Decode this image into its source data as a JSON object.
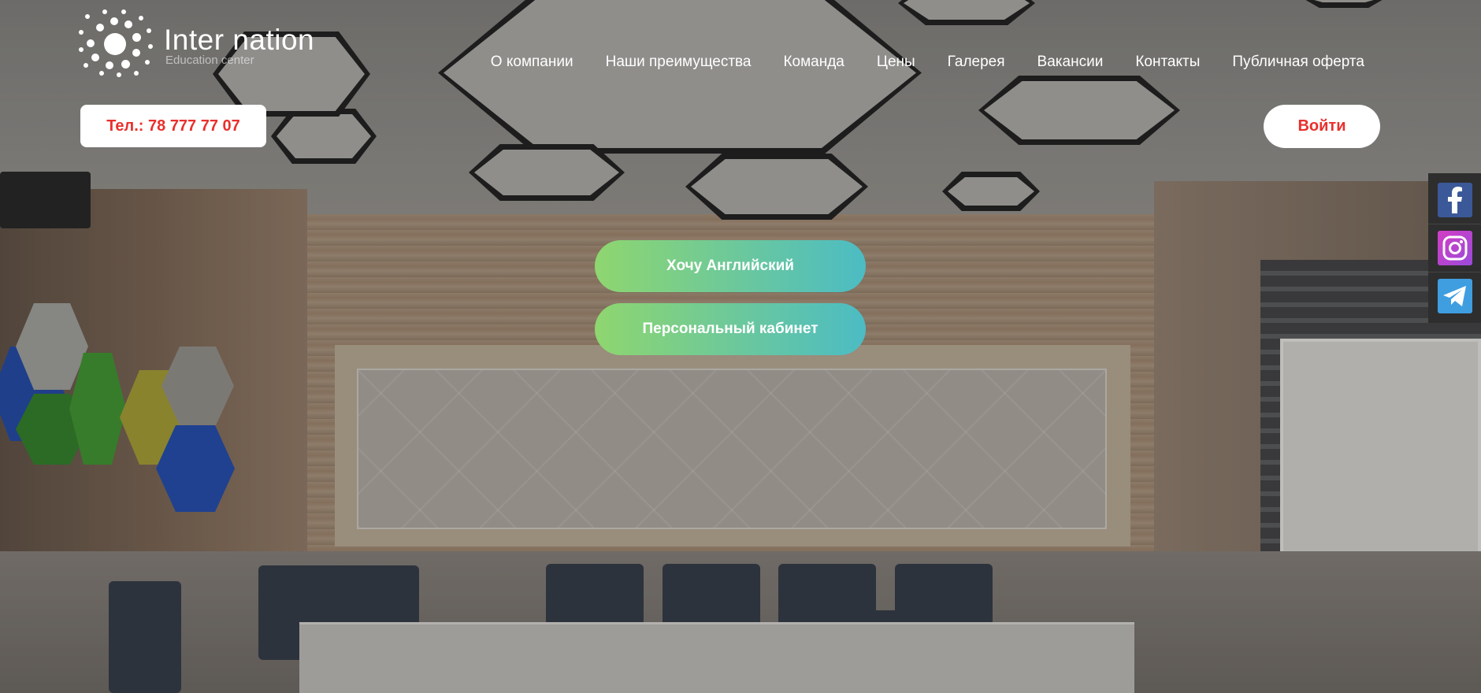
{
  "header": {
    "logo_title": "Inter nation",
    "logo_subtitle": "Education center",
    "nav": [
      "О компании",
      "Наши преимущества",
      "Команда",
      "Цены",
      "Галерея",
      "Вакансии",
      "Контакты",
      "Публичная оферта"
    ],
    "phone_label": "Тел.: 78 777 77 07",
    "login_label": "Войти"
  },
  "hero": {
    "cta_primary": "Хочу Английский",
    "cta_secondary": "Персональный кабинет"
  },
  "social": [
    {
      "icon": "facebook-icon"
    },
    {
      "icon": "instagram-icon"
    },
    {
      "icon": "telegram-icon"
    }
  ],
  "colors": {
    "accent_red": "#e8302d",
    "cta_gradient_start": "#8fd66f",
    "cta_gradient_end": "#4cbcc4",
    "facebook": "#3b5998",
    "instagram": "#c13ec9",
    "telegram": "#3f9ee0"
  }
}
